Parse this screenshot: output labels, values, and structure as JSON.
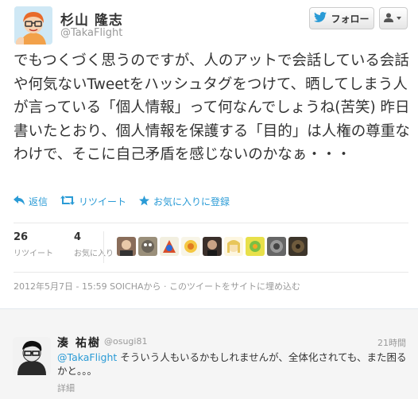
{
  "tweet": {
    "fullname": "杉山 隆志",
    "screen_name": "@TakaFlight",
    "follow_label": "フォロー",
    "text": "でもつくづく思うのですが、人のアットで会話している会話や何気ないTweetをハッシュタグをつけて、晒してしまう人が言っている「個人情報」って何なんでしょうね(苦笑) 昨日書いたとおり、個人情報を保護する「目的」は人権の尊重なわけで、そこに自己矛盾を感じないのかなぁ・・・",
    "actions": {
      "reply": "返信",
      "retweet": "リツイート",
      "favorite": "お気に入りに登録"
    },
    "stats": {
      "retweets_count": "26",
      "retweets_label": "リツイート",
      "favorites_count": "4",
      "favorites_label": "お気に入り"
    },
    "meta": "2012年5月7日 - 15:59 SOICHAから · このツイートをサイトに埋め込む"
  },
  "reply": {
    "fullname": "湊 祐樹",
    "screen_name": "@osugi81",
    "time": "21時間",
    "mention": "@TakaFlight",
    "text": " そういう人もいるかもしれませんが、全体化されても、また困るかと。。。",
    "detail": "詳細"
  },
  "colors": {
    "link": "#2a9bd6",
    "muted": "#999999",
    "text": "#333333"
  }
}
